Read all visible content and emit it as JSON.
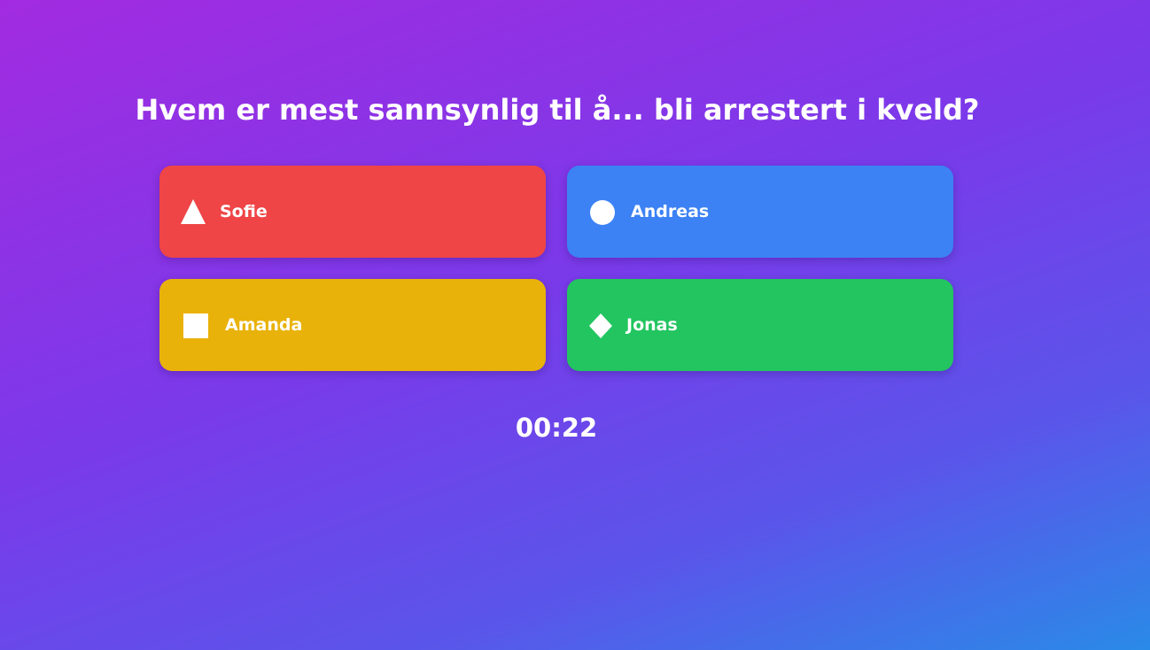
{
  "question": "Hvem er mest sannsynlig til å... bli arrestert i kveld?",
  "options": [
    {
      "label": "Sofie",
      "icon": "triangle-icon",
      "color": "#ef4546"
    },
    {
      "label": "Andreas",
      "icon": "circle-icon",
      "color": "#3c82f5"
    },
    {
      "label": "Amanda",
      "icon": "square-icon",
      "color": "#e9b20a"
    },
    {
      "label": "Jonas",
      "icon": "diamond-icon",
      "color": "#22c55f"
    }
  ],
  "timer": "00:22"
}
